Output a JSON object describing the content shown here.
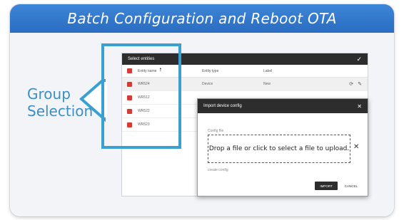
{
  "banner": {
    "title": "Batch Configuration and Reboot OTA"
  },
  "callout": {
    "line1": "Group",
    "line2": "Selection"
  },
  "entities_panel": {
    "title": "Select entities",
    "columns": {
      "name": "Entity name",
      "type": "Entity type",
      "label": "Label"
    },
    "rows": [
      {
        "name": "WR524",
        "type": "Device",
        "label": "New"
      },
      {
        "name": "WR512",
        "type": "",
        "label": ""
      },
      {
        "name": "WR522",
        "type": "",
        "label": ""
      },
      {
        "name": "WR523",
        "type": "",
        "label": ""
      }
    ]
  },
  "dialog": {
    "title": "Import device config",
    "field_label": "Config file",
    "dropzone_text": "Drop a file or click to select a file to upload.",
    "hint": "create config",
    "import_label": "IMPORT",
    "cancel_label": "CANCEL"
  },
  "colors": {
    "banner": "#2f73c8",
    "highlight": "#3aa0d2",
    "checkbox": "#d63a34",
    "header": "#2d2d2d"
  }
}
